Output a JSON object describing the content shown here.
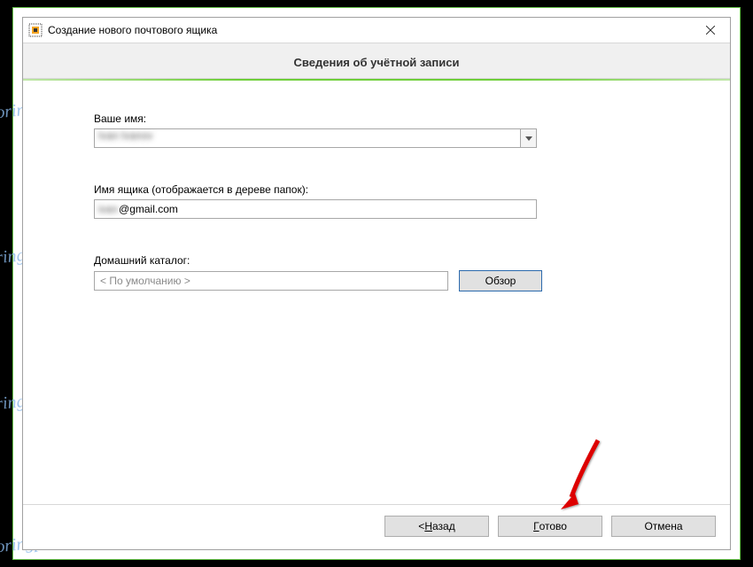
{
  "window": {
    "title": "Создание нового почтового ящика"
  },
  "header": {
    "heading": "Сведения об учётной записи"
  },
  "fields": {
    "name": {
      "label": "Ваше имя:",
      "value": "Ivan Ivanov"
    },
    "mailbox": {
      "label": "Имя ящика (отображается в дереве папок):",
      "value_prefix": "ivan",
      "value_suffix": "@gmail.com"
    },
    "home": {
      "label": "Домашний каталог:",
      "value": "< По умолчанию >",
      "browse_label": "Обзор"
    }
  },
  "footer": {
    "back_prefix": "<  ",
    "back_u": "Н",
    "back_suffix": "азад",
    "finish_u": "Г",
    "finish_suffix": "отово",
    "cancel": "Отмена"
  },
  "watermark": "Soringperepair.Com"
}
